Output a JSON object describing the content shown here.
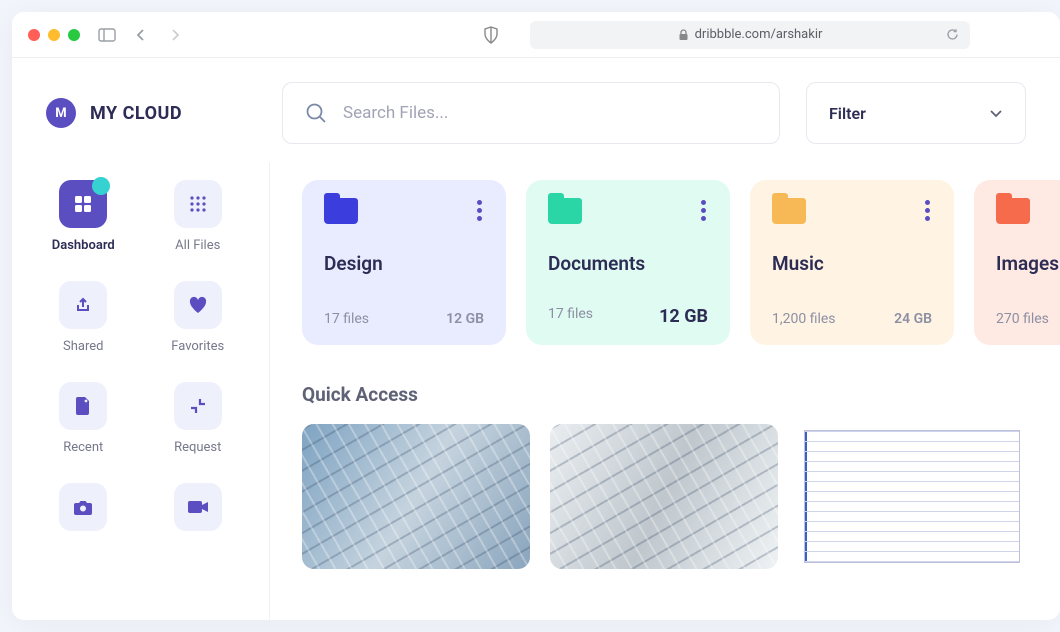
{
  "browser": {
    "url": "dribbble.com/arshakir"
  },
  "app": {
    "logo_letter": "M",
    "title": "MY CLOUD"
  },
  "search": {
    "placeholder": "Search Files..."
  },
  "filter": {
    "label": "Filter"
  },
  "sidebar": [
    {
      "label": "Dashboard",
      "icon": "dashboard",
      "active": true
    },
    {
      "label": "All Files",
      "icon": "grid",
      "active": false
    },
    {
      "label": "Shared",
      "icon": "share",
      "active": false
    },
    {
      "label": "Favorites",
      "icon": "heart",
      "active": false
    },
    {
      "label": "Recent",
      "icon": "file",
      "active": false
    },
    {
      "label": "Request",
      "icon": "collapse",
      "active": false
    },
    {
      "label": "",
      "icon": "camera",
      "active": false
    },
    {
      "label": "",
      "icon": "video",
      "active": false
    }
  ],
  "folders": [
    {
      "name": "Design",
      "files": "17 files",
      "size": "12 GB",
      "color": "#3b3edc",
      "tint": "#e9ecff",
      "text": "#2c2c54",
      "size_bold": false
    },
    {
      "name": "Documents",
      "files": "17 files",
      "size": "12 GB",
      "color": "#2bd6a6",
      "tint": "#e0fbf2",
      "text": "#2c2c54",
      "size_bold": true
    },
    {
      "name": "Music",
      "files": "1,200 files",
      "size": "24 GB",
      "color": "#f7b955",
      "tint": "#fff4e3",
      "text": "#2c2c54",
      "size_bold": false
    },
    {
      "name": "Images",
      "files": "270 files",
      "size": "",
      "color": "#f76b4d",
      "tint": "#ffe9e3",
      "text": "#2c2c54",
      "size_bold": false
    }
  ],
  "quick_access": {
    "title": "Quick Access",
    "items": [
      "building-1",
      "building-2",
      "spreadsheet"
    ]
  }
}
